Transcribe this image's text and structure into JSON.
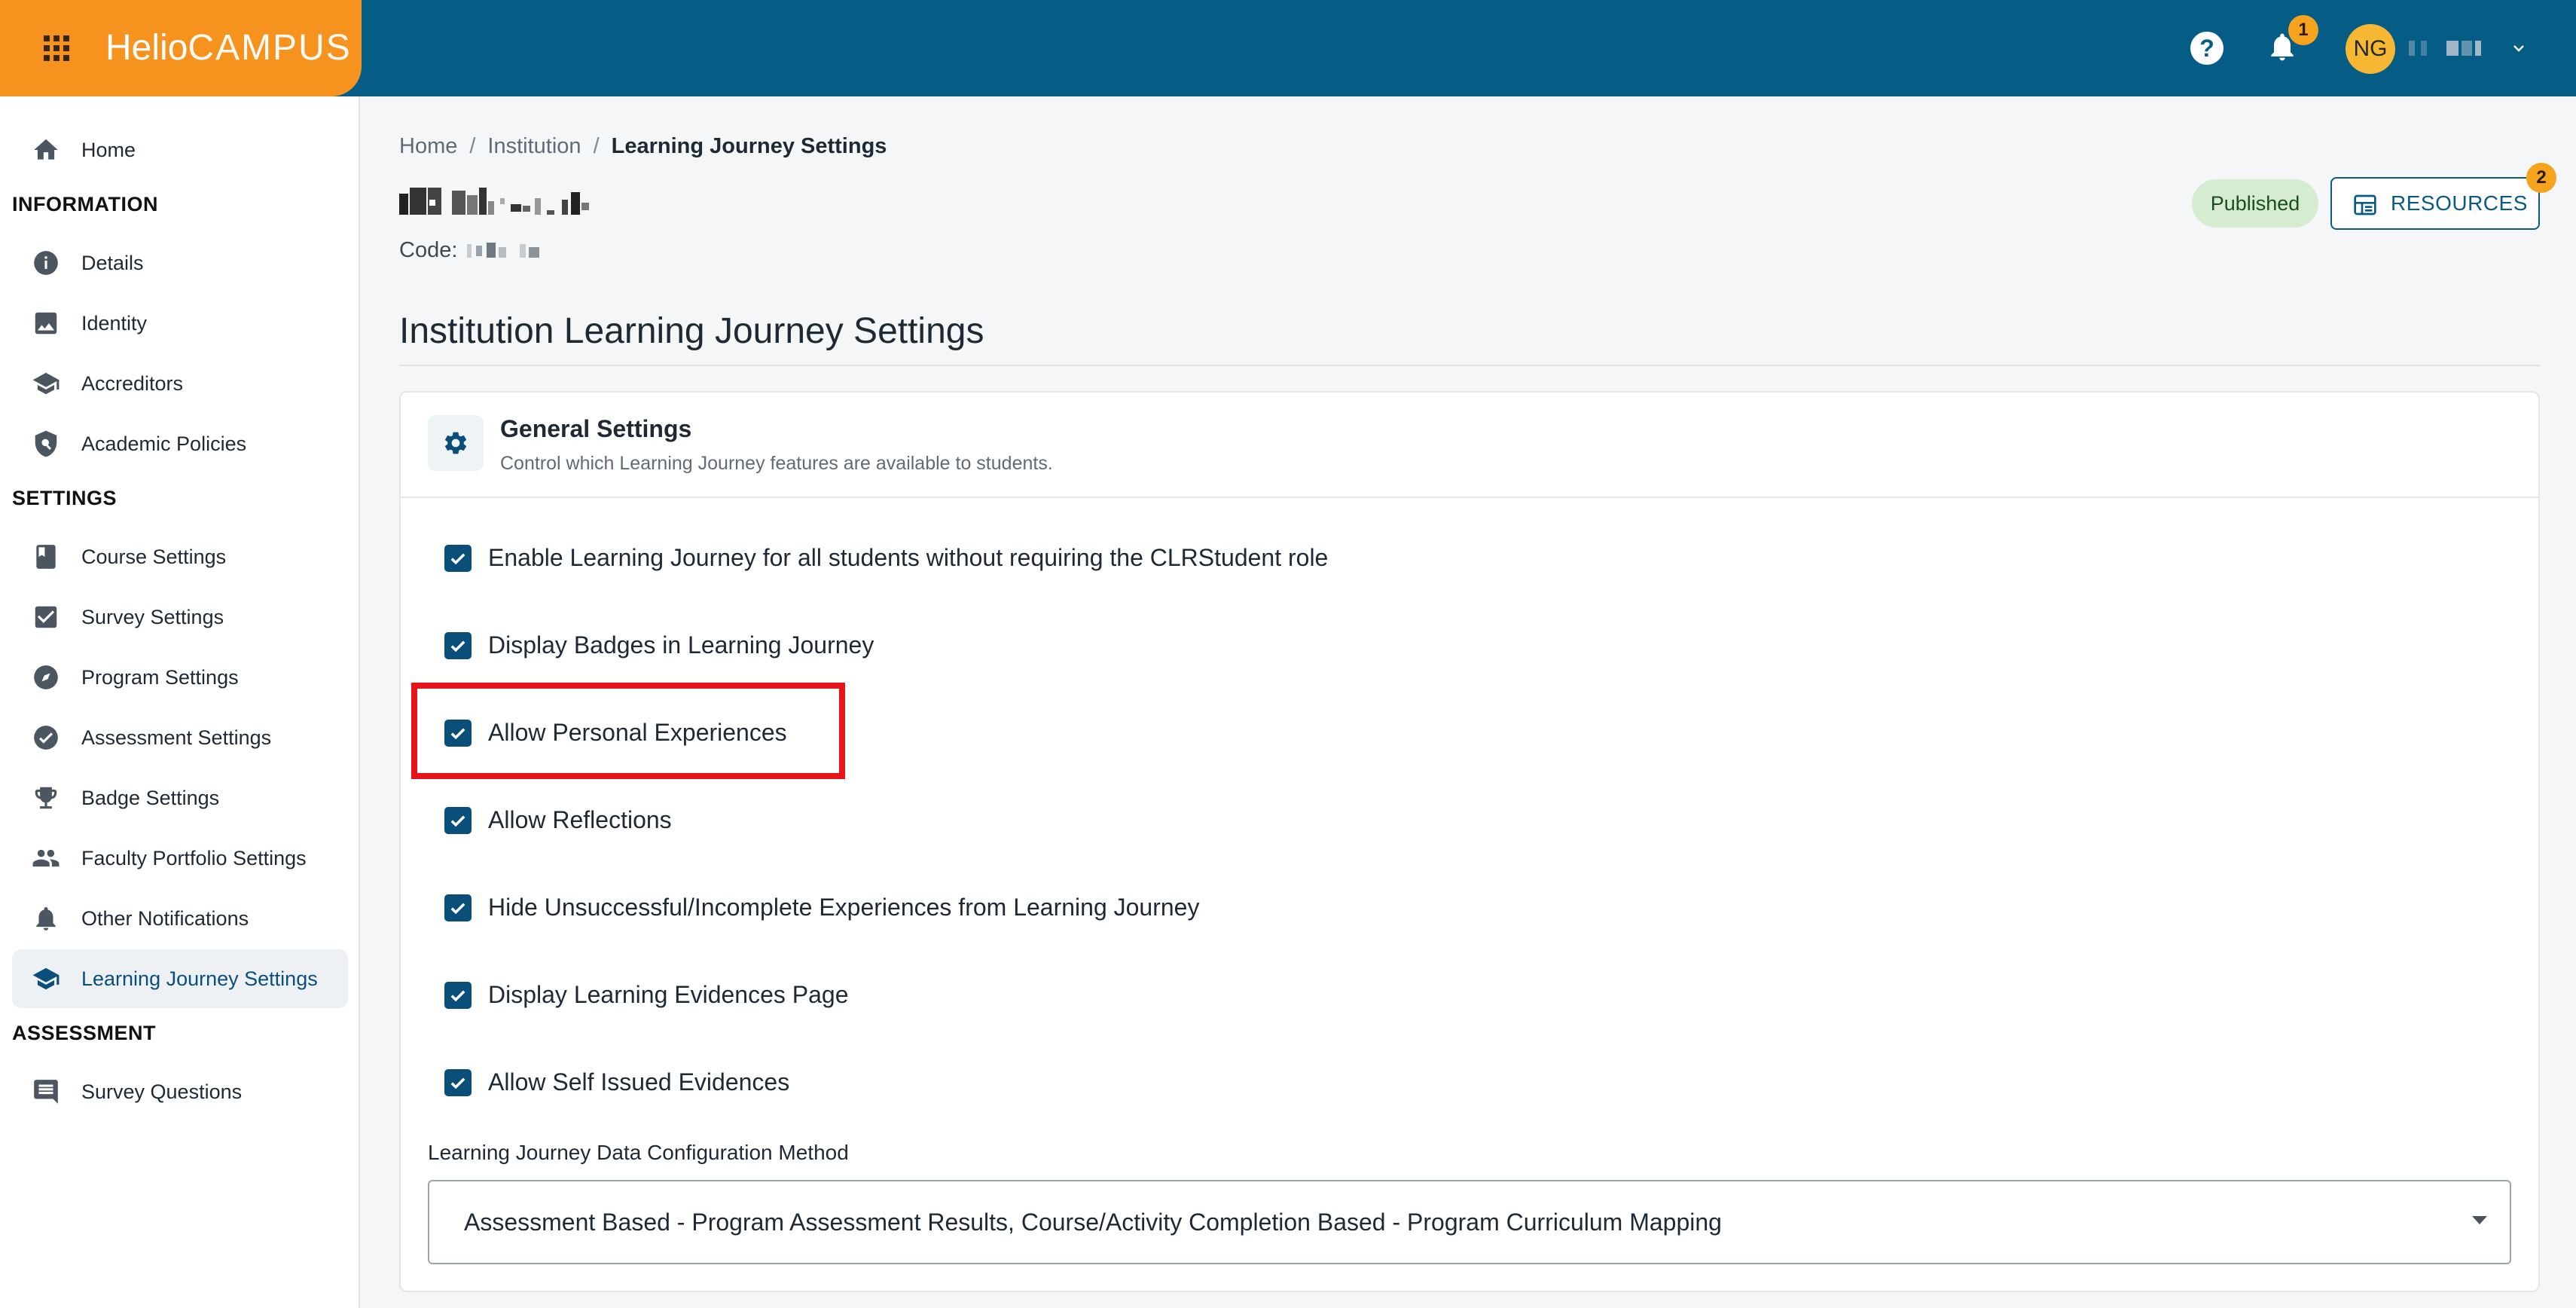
{
  "app": {
    "logo_part1": "Helio",
    "logo_part2": "CAMPUS",
    "brand_color": "#f6931e",
    "header_color": "#055d85",
    "accent_color": "#0a4f7a"
  },
  "topbar": {
    "help_icon": "help-circle-icon",
    "notifications_count": "1",
    "user_initials": "NG"
  },
  "sidebar": {
    "home": {
      "label": "Home",
      "icon": "home-icon"
    },
    "sections": [
      {
        "title": "INFORMATION",
        "items": [
          {
            "label": "Details",
            "icon": "info-icon"
          },
          {
            "label": "Identity",
            "icon": "image-icon"
          },
          {
            "label": "Accreditors",
            "icon": "graduation-cap-icon"
          },
          {
            "label": "Academic Policies",
            "icon": "shield-search-icon"
          }
        ]
      },
      {
        "title": "SETTINGS",
        "items": [
          {
            "label": "Course Settings",
            "icon": "book-icon"
          },
          {
            "label": "Survey Settings",
            "icon": "check-square-icon"
          },
          {
            "label": "Program Settings",
            "icon": "compass-icon"
          },
          {
            "label": "Assessment Settings",
            "icon": "check-circle-icon"
          },
          {
            "label": "Badge Settings",
            "icon": "trophy-icon"
          },
          {
            "label": "Faculty Portfolio Settings",
            "icon": "people-icon"
          },
          {
            "label": "Other Notifications",
            "icon": "bell-icon"
          },
          {
            "label": "Learning Journey Settings",
            "icon": "graduation-cap-icon",
            "active": true
          }
        ]
      },
      {
        "title": "ASSESSMENT",
        "items": [
          {
            "label": "Survey Questions",
            "icon": "comment-icon"
          }
        ]
      }
    ]
  },
  "breadcrumb": [
    "Home",
    "Institution",
    "Learning Journey Settings"
  ],
  "breadcrumb_separator": "/",
  "record": {
    "code_label": "Code:"
  },
  "header_actions": {
    "status": "Published",
    "resources_label": "RESOURCES",
    "resources_badge": "2"
  },
  "page": {
    "heading": "Institution Learning Journey Settings"
  },
  "general_settings": {
    "title": "General Settings",
    "subtitle": "Control which Learning Journey features are available to students.",
    "options": [
      {
        "label": "Enable Learning Journey for all students without requiring the CLRStudent role",
        "checked": true
      },
      {
        "label": "Display Badges in Learning Journey",
        "checked": true
      },
      {
        "label": "Allow Personal Experiences",
        "checked": true
      },
      {
        "label": "Allow Reflections",
        "checked": true
      },
      {
        "label": "Hide Unsuccessful/Incomplete Experiences from Learning Journey",
        "checked": true
      },
      {
        "label": "Display Learning Evidences Page",
        "checked": true
      },
      {
        "label": "Allow Self Issued Evidences",
        "checked": true
      }
    ],
    "config_method_label": "Learning Journey Data Configuration Method",
    "config_method_value": "Assessment Based - Program Assessment Results, Course/Activity Completion Based - Program Curriculum Mapping"
  }
}
